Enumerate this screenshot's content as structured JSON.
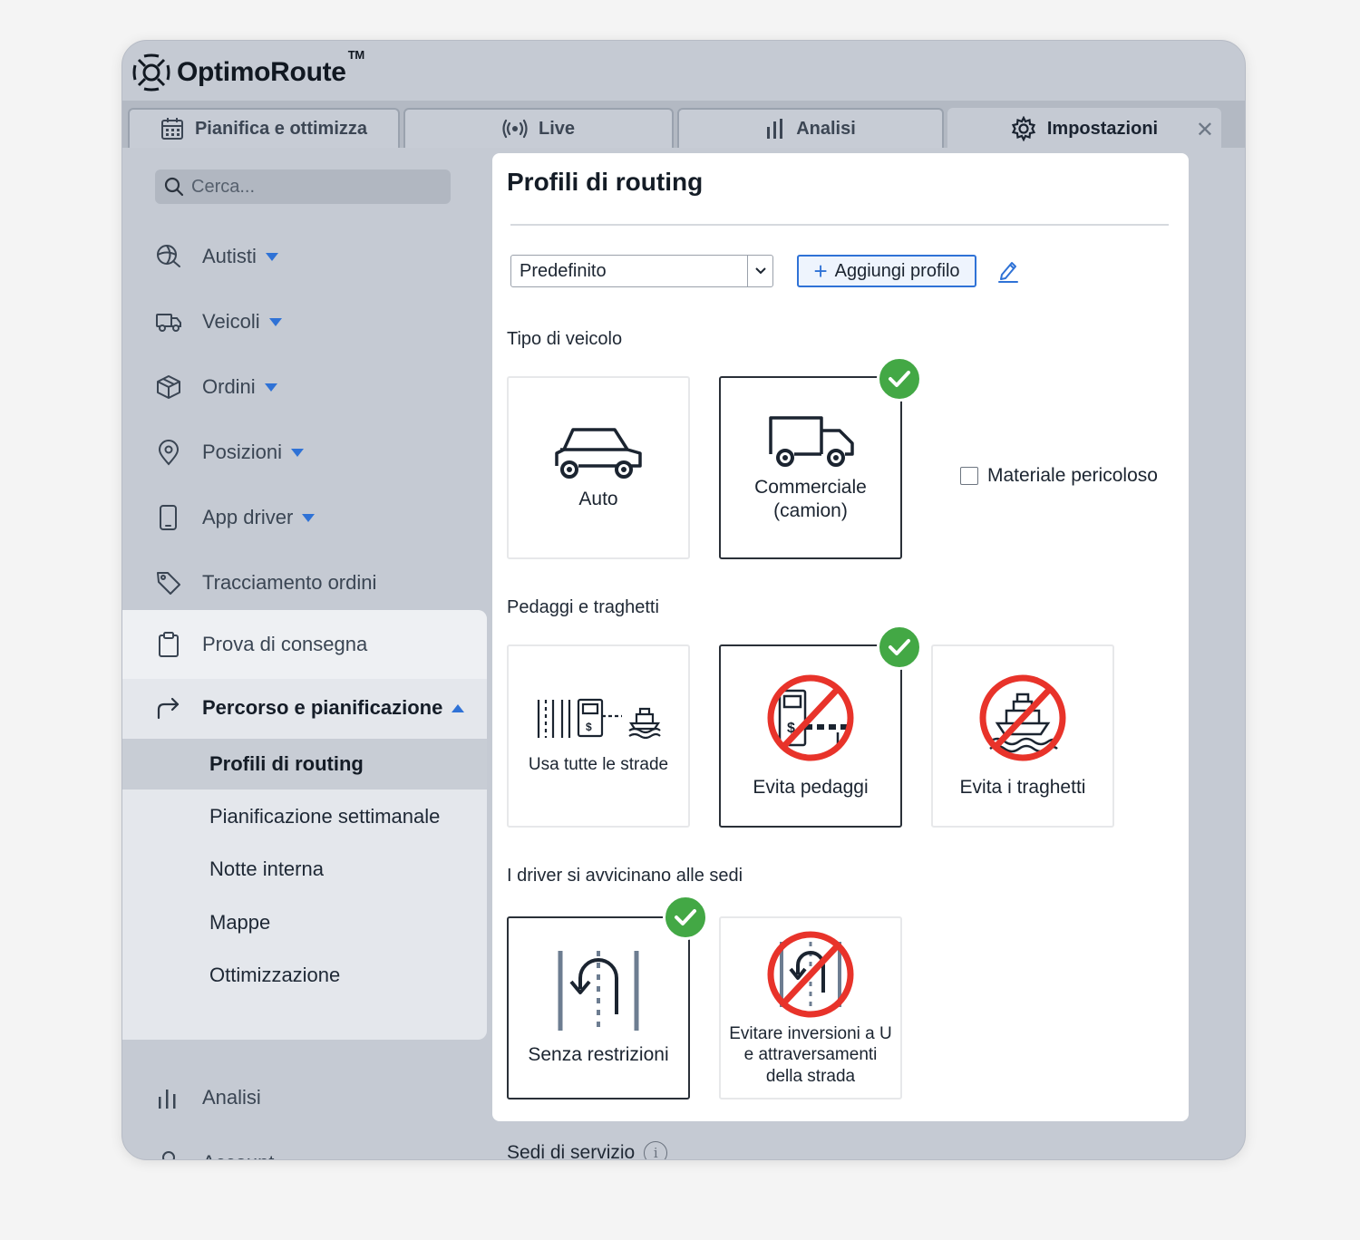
{
  "app": {
    "name": "OptimoRoute",
    "trademark": "TM"
  },
  "tabs": [
    {
      "label": "Pianifica e ottimizza",
      "icon": "calendar-icon"
    },
    {
      "label": "Live",
      "icon": "broadcast-icon"
    },
    {
      "label": "Analisi",
      "icon": "bar-chart-icon"
    },
    {
      "label": "Impostazioni",
      "icon": "gear-icon",
      "active": true
    }
  ],
  "search": {
    "placeholder": "Cerca..."
  },
  "sidebar": {
    "items": [
      {
        "label": "Autisti",
        "icon": "driver-icon",
        "expandable": true
      },
      {
        "label": "Veicoli",
        "icon": "truck-icon",
        "expandable": true
      },
      {
        "label": "Ordini",
        "icon": "box-icon",
        "expandable": true
      },
      {
        "label": "Posizioni",
        "icon": "location-pin-icon",
        "expandable": true
      },
      {
        "label": "App driver",
        "icon": "phone-icon",
        "expandable": true
      },
      {
        "label": "Tracciamento ordini",
        "icon": "tag-icon",
        "expandable": false
      },
      {
        "label": "Prova di consegna",
        "icon": "clipboard-icon",
        "expandable": false
      },
      {
        "label": "Percorso e pianificazione",
        "icon": "route-arrow-icon",
        "expanded": true
      },
      {
        "label": "Analisi",
        "icon": "bar-chart-icon",
        "expandable": false
      },
      {
        "label": "Account",
        "icon": "user-icon",
        "expandable": true
      }
    ],
    "subitems": [
      {
        "label": "Profili di routing",
        "active": true
      },
      {
        "label": "Pianificazione settimanale"
      },
      {
        "label": "Notte interna"
      },
      {
        "label": "Mappe"
      },
      {
        "label": "Ottimizzazione"
      }
    ]
  },
  "main": {
    "title": "Profili di routing",
    "profile_select": {
      "value": "Predefinito"
    },
    "add_profile_label": "Aggiungi profilo",
    "vehicle_type": {
      "label": "Tipo di veicolo",
      "options": [
        {
          "label": "Auto",
          "selected": false
        },
        {
          "label": "Commerciale\n(camion)",
          "selected": true
        }
      ],
      "hazmat_label": "Materiale pericoloso",
      "hazmat_checked": false
    },
    "tolls_ferries": {
      "label": "Pedaggi e traghetti",
      "options": [
        {
          "label": "Usa tutte le strade",
          "selected": false
        },
        {
          "label": "Evita pedaggi",
          "selected": true
        },
        {
          "label": "Evita i traghetti",
          "selected": false
        }
      ]
    },
    "approach": {
      "label": "I driver si avvicinano alle sedi",
      "options": [
        {
          "label": "Senza restrizioni",
          "selected": true
        },
        {
          "label": "Evitare inversioni a U e attraversamenti della strada",
          "selected": false
        }
      ]
    },
    "service_sites_label": "Sedi di servizio"
  },
  "colors": {
    "accent": "#2f72d6",
    "check": "#43a845",
    "prohibit": "#e8332a"
  }
}
